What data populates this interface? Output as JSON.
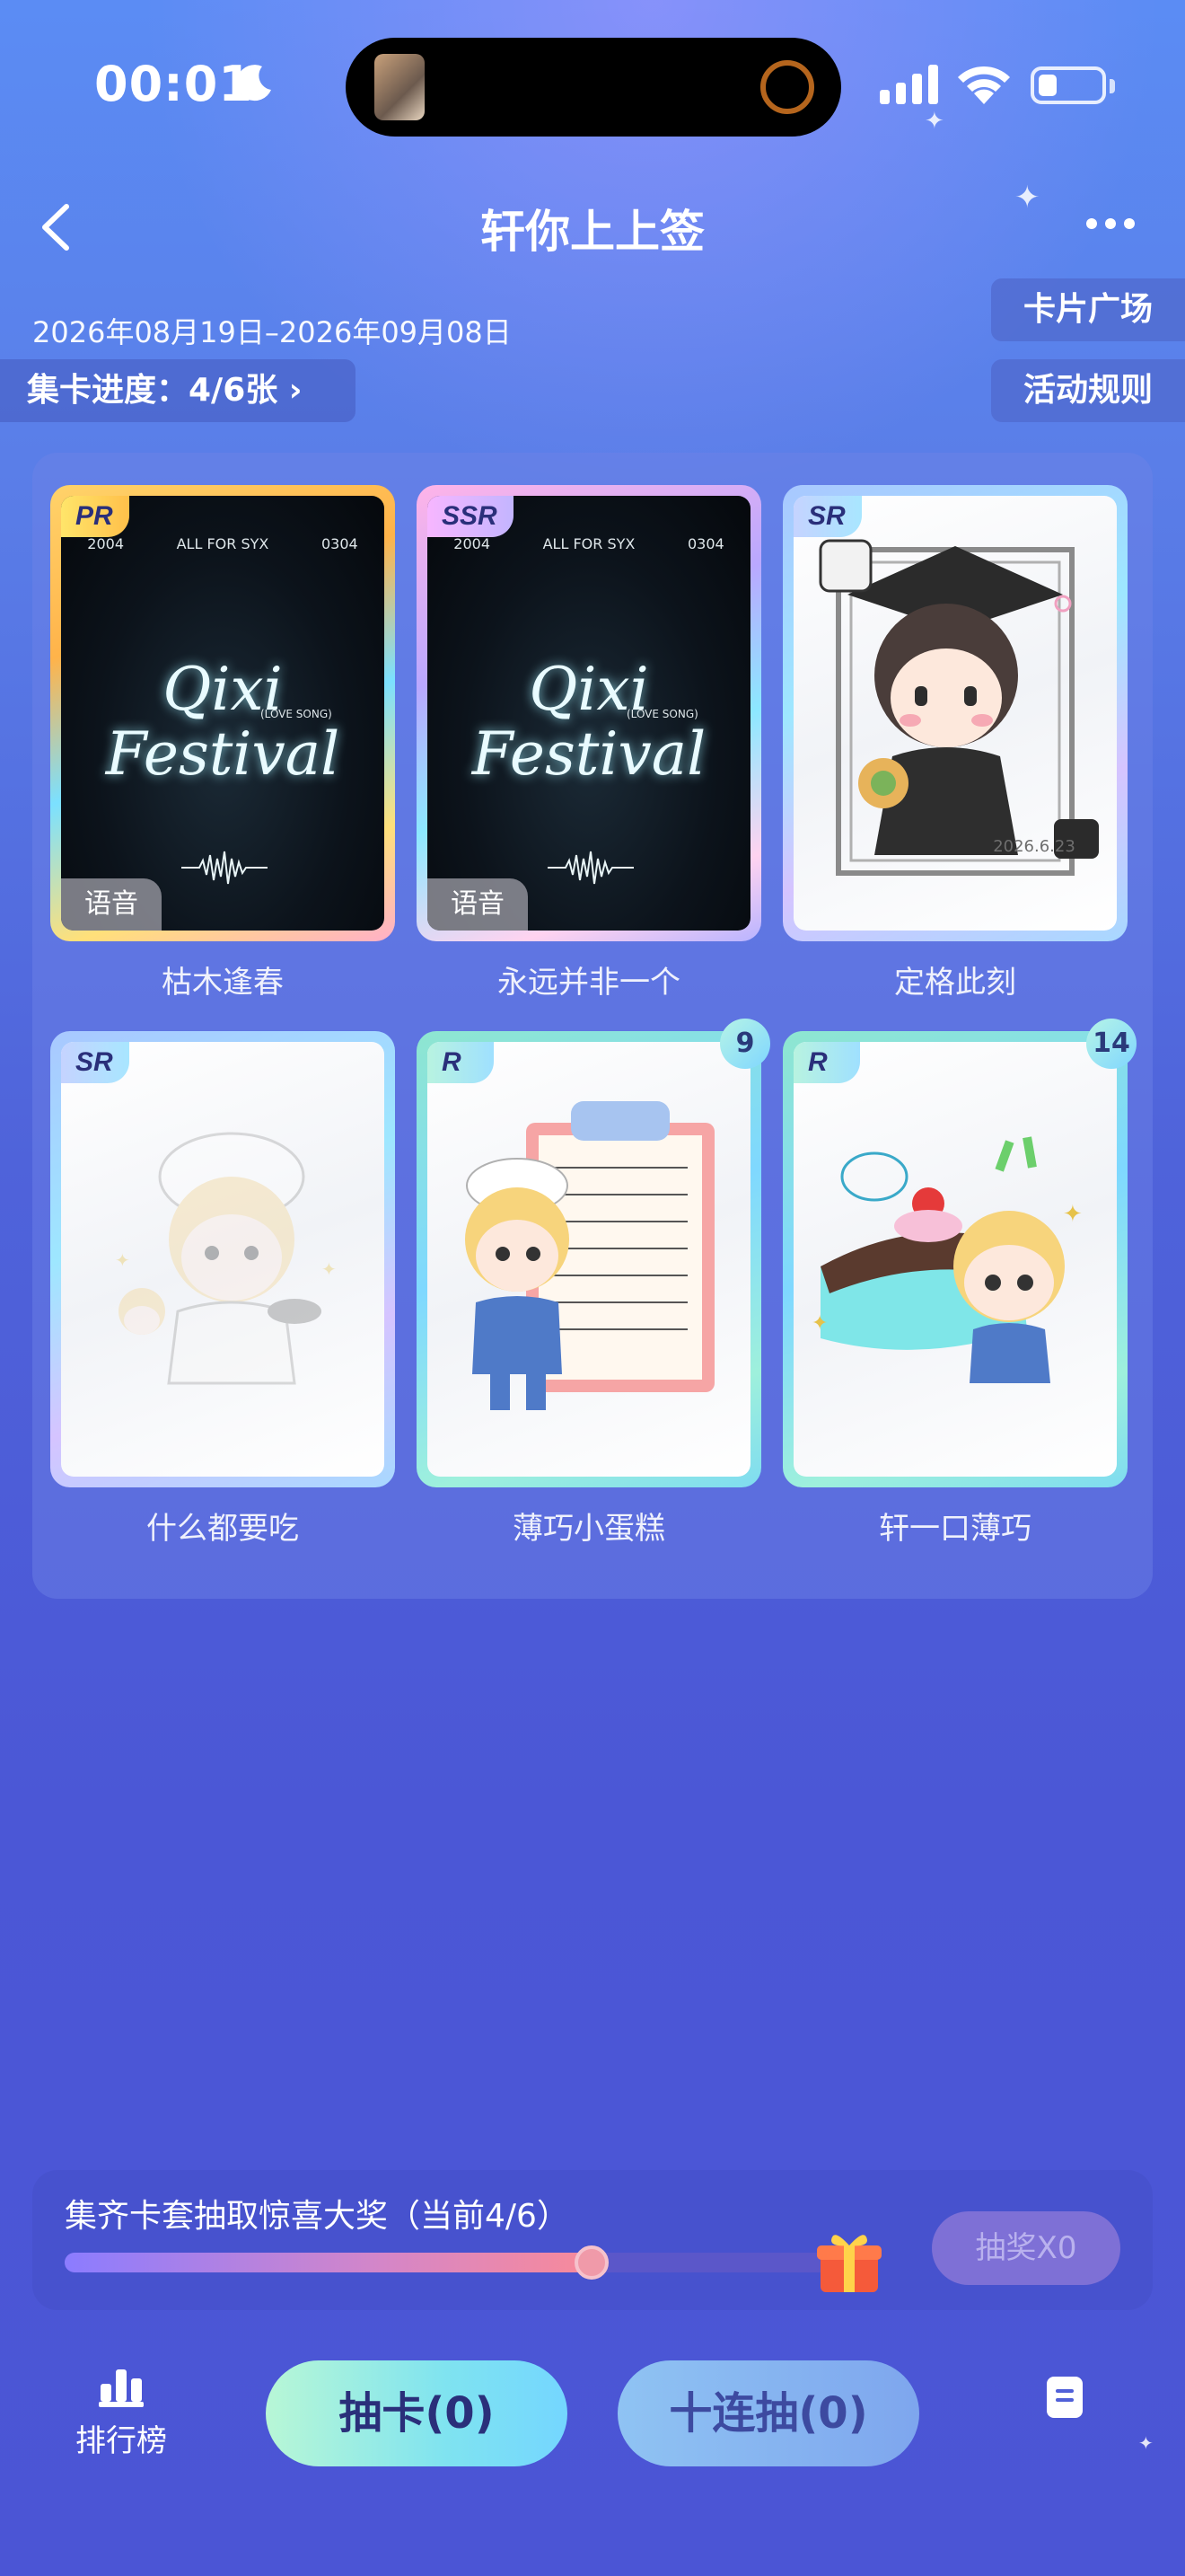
{
  "status_bar": {
    "time": "00:01"
  },
  "header": {
    "title": "轩你上上签"
  },
  "event": {
    "date_range": "2026年08月19日–2026年09月08日",
    "progress_label": "集卡进度：4/6张",
    "card_plaza_label": "卡片广场",
    "rules_label": "活动规则"
  },
  "cards": [
    {
      "rarity": "PR",
      "name": "枯木逢春",
      "voice": "语音",
      "top_left": "2004",
      "top_mid": "ALL FOR SYX",
      "top_right": "0304",
      "art_title": "Qixi",
      "art_subtitle": "Festival",
      "art_tag": "(LOVE SONG)"
    },
    {
      "rarity": "SSR",
      "name": "永远并非一个",
      "voice": "语音",
      "top_left": "2004",
      "top_mid": "ALL FOR SYX",
      "top_right": "0304",
      "art_title": "Qixi",
      "art_subtitle": "Festival",
      "art_tag": "(LOVE SONG)"
    },
    {
      "rarity": "SR",
      "name": "定格此刻",
      "art_date": "2026.6.23"
    },
    {
      "rarity": "SR",
      "name": "什么都要吃"
    },
    {
      "rarity": "R",
      "name": "薄巧小蛋糕",
      "count": "9"
    },
    {
      "rarity": "R",
      "name": "轩一口薄巧",
      "count": "14"
    }
  ],
  "prize": {
    "text": "集齐卡套抽取惊喜大奖（当前4/6）",
    "progress_fraction": 0.667,
    "lottery_label": "抽奖X0"
  },
  "bottom_nav": {
    "rank_label": "排行榜",
    "draw_label": "抽卡(0)",
    "draw10_label": "十连抽(0)"
  },
  "colors": {
    "accent": "#4f63da",
    "draw_button": "#7fe3f0",
    "prize_track": "#f88a9a"
  }
}
